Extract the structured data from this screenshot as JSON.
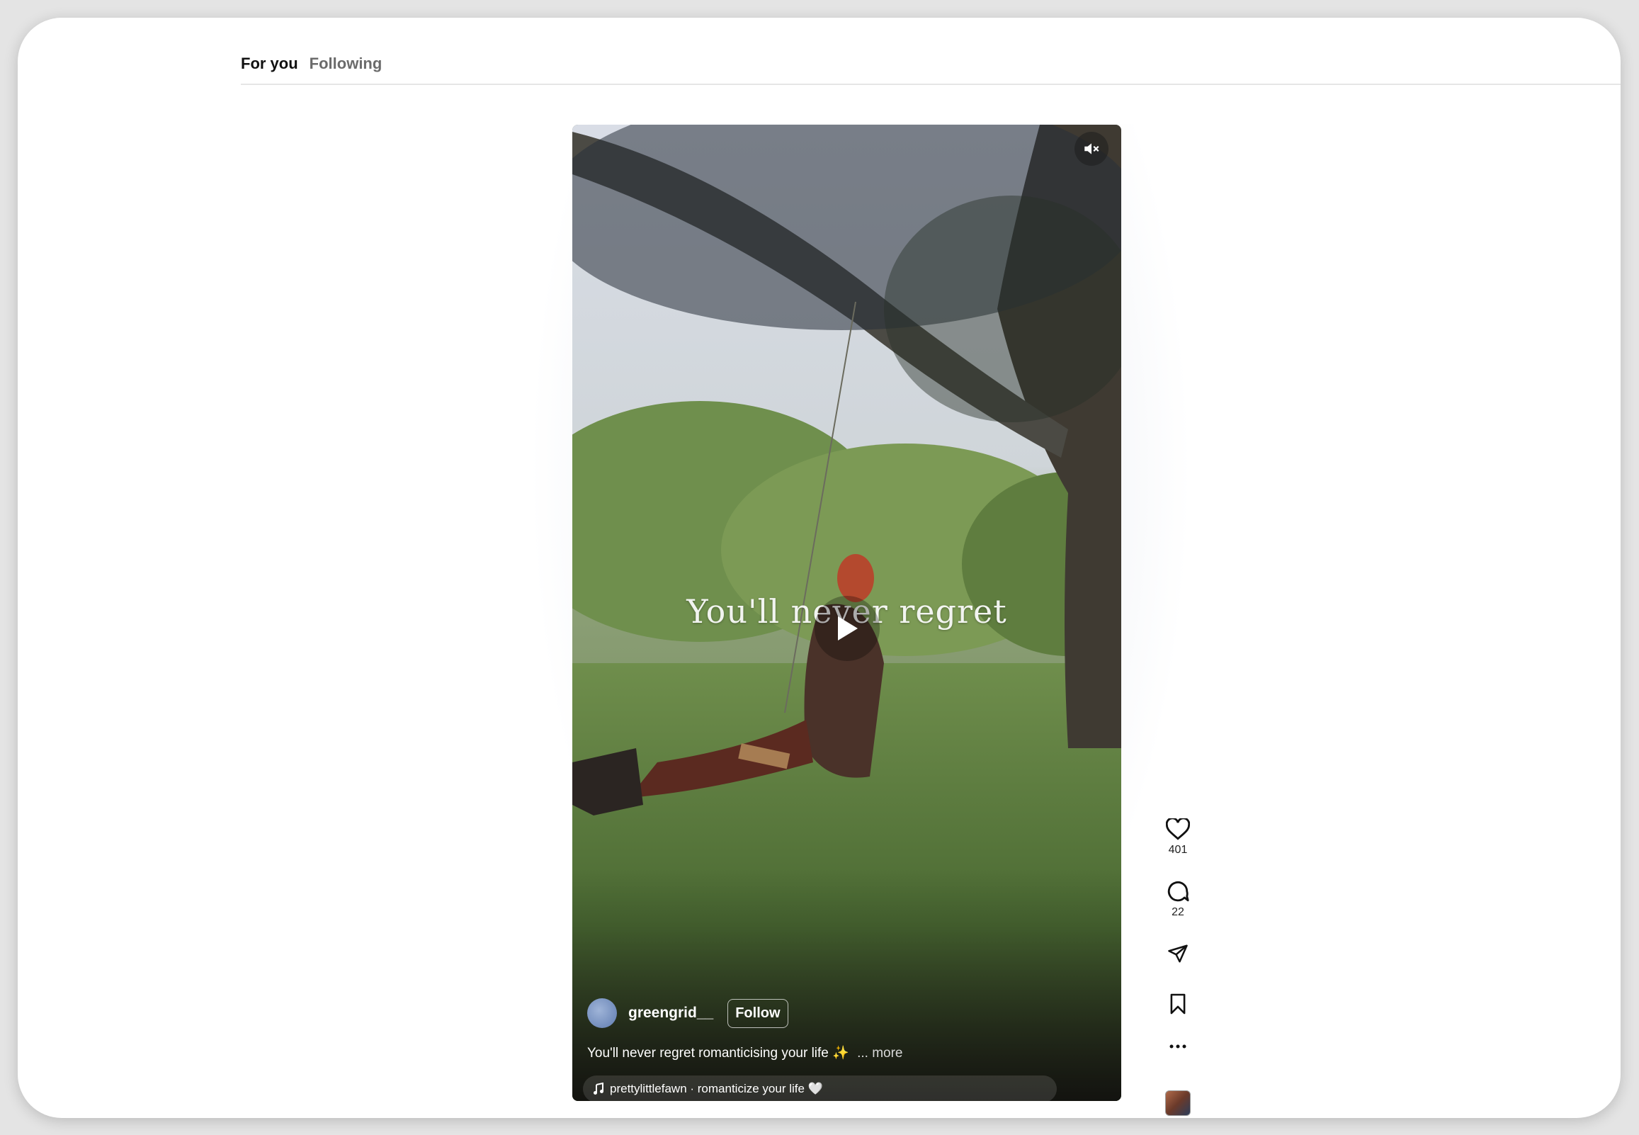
{
  "tabs": [
    {
      "label": "For you",
      "active": true
    },
    {
      "label": "Following",
      "active": false
    }
  ],
  "video": {
    "overlay_text": "You'll never regret",
    "author": {
      "username": "greengrid__",
      "follow_label": "Follow"
    },
    "caption": "You'll never regret romanticising your life ✨",
    "caption_more": "... more",
    "audio": "prettylittlefawn · romanticize your life 🤍",
    "mute_icon": "muted-speaker-icon",
    "play_icon": "play-icon"
  },
  "actions": {
    "likes": "401",
    "comments": "22",
    "icons": [
      "heart-icon",
      "comment-icon",
      "send-icon",
      "bookmark-icon",
      "more-icon"
    ]
  },
  "colors": {
    "text_primary": "#111111",
    "text_secondary": "#6b6b6b",
    "overlay_white": "#ffffff"
  }
}
